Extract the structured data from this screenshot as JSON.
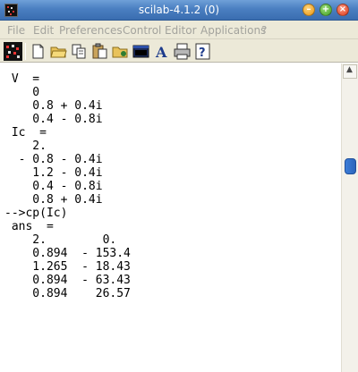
{
  "window": {
    "title": "scilab-4.1.2 (0)"
  },
  "menubar": {
    "items": [
      {
        "label": "File"
      },
      {
        "label": "Edit"
      },
      {
        "label": "Preferences"
      },
      {
        "label": "Control"
      },
      {
        "label": "Editor"
      },
      {
        "label": "Applications"
      },
      {
        "label": "?"
      }
    ]
  },
  "toolbar": {
    "buttons": [
      {
        "icon": "scilab-logo-icon"
      },
      {
        "icon": "new-file-icon"
      },
      {
        "icon": "open-folder-icon"
      },
      {
        "icon": "copy-icon"
      },
      {
        "icon": "paste-icon"
      },
      {
        "icon": "change-directory-icon"
      },
      {
        "icon": "console-window-icon"
      },
      {
        "icon": "font-icon"
      },
      {
        "icon": "print-icon"
      },
      {
        "icon": "help-icon"
      }
    ]
  },
  "console": {
    "lines": [
      " V  =",
      "",
      "    0",
      "    0.8 + 0.4i",
      "    0.4 - 0.8i",
      " Ic  =",
      "",
      "    2.",
      "  - 0.8 - 0.4i",
      "    1.2 - 0.4i",
      "    0.4 - 0.8i",
      "    0.8 + 0.4i",
      "",
      "",
      "-->cp(Ic)",
      " ans  =",
      "",
      "    2.        0.",
      "    0.894  - 153.4",
      "    1.265  - 18.43",
      "    0.894  - 63.43",
      "    0.894    26.57"
    ]
  },
  "colors": {
    "titlebar": "#4a7fc1",
    "menubar": "#ece9d8",
    "menu_text_disabled": "#a3a39d",
    "scroll_thumb": "#3d7ed8"
  }
}
